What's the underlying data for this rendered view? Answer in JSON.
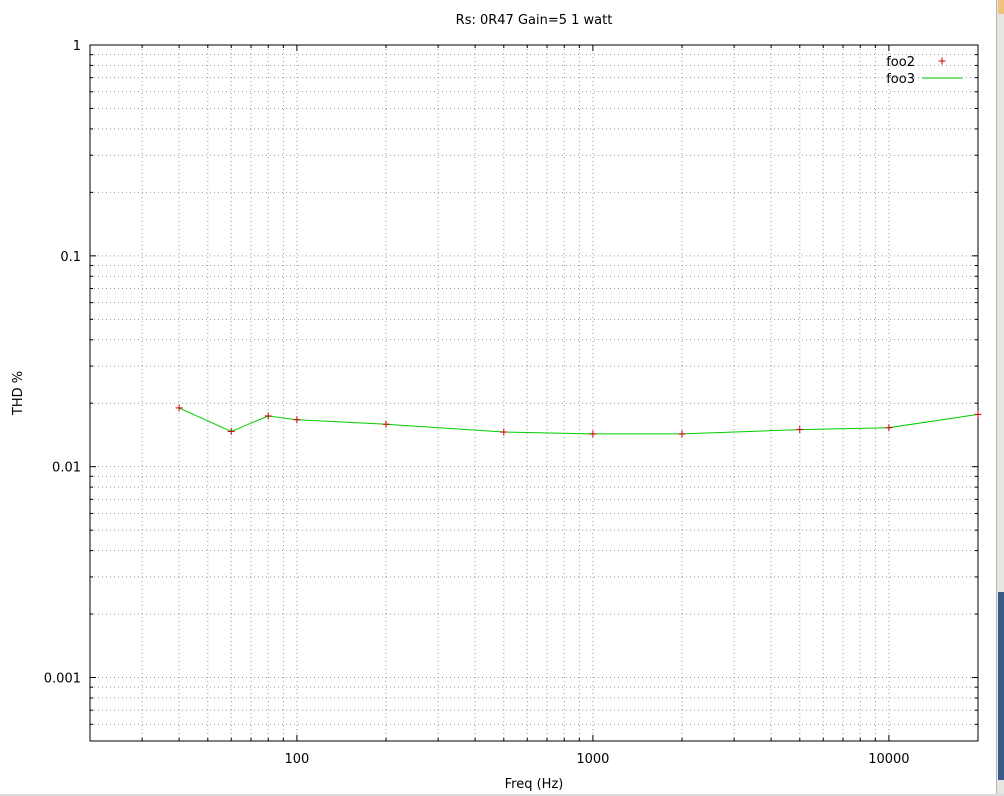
{
  "chart_data": {
    "type": "line",
    "title": "Rs: 0R47  Gain=5 1 watt",
    "xlabel": "Freq (Hz)",
    "ylabel": "THD %",
    "xscale": "log",
    "yscale": "log",
    "xlim": [
      20,
      20000
    ],
    "ylim": [
      0.0005,
      1
    ],
    "xticks": [
      {
        "value": 100,
        "label": "100"
      },
      {
        "value": 1000,
        "label": "1000"
      },
      {
        "value": 10000,
        "label": "10000"
      }
    ],
    "yticks": [
      {
        "value": 0.001,
        "label": "0.001"
      },
      {
        "value": 0.01,
        "label": "0.01"
      },
      {
        "value": 0.1,
        "label": "0.1"
      },
      {
        "value": 1,
        "label": "1"
      }
    ],
    "grid": true,
    "legend_position": "top-right",
    "series": [
      {
        "name": "foo2",
        "style": "points",
        "marker": "+",
        "color": "#cc0000",
        "x": [
          40,
          60,
          80,
          100,
          200,
          500,
          1000,
          2000,
          5000,
          10000,
          20000
        ],
        "y": [
          0.019,
          0.0147,
          0.0174,
          0.0167,
          0.0159,
          0.0146,
          0.0143,
          0.0143,
          0.015,
          0.0153,
          0.0177
        ]
      },
      {
        "name": "foo3",
        "style": "line",
        "color": "#00cc00",
        "x": [
          40,
          60,
          80,
          100,
          200,
          500,
          1000,
          2000,
          5000,
          10000,
          20000
        ],
        "y": [
          0.019,
          0.0147,
          0.0174,
          0.0167,
          0.0159,
          0.0146,
          0.0143,
          0.0143,
          0.015,
          0.0153,
          0.0177
        ]
      }
    ]
  }
}
